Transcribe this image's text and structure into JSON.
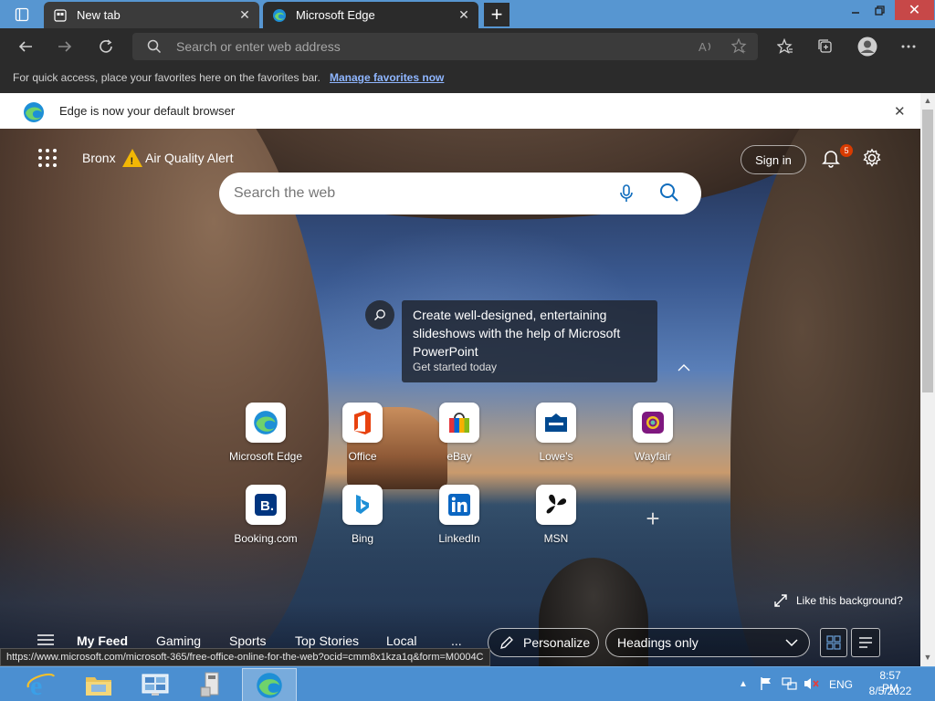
{
  "tabs": [
    {
      "title": "New tab",
      "icon": "newtab-icon"
    },
    {
      "title": "Microsoft Edge",
      "icon": "edge-logo-icon"
    }
  ],
  "toolbar": {
    "address_placeholder": "Search or enter web address"
  },
  "favorites_bar": {
    "message": "For quick access, place your favorites here on the favorites bar.",
    "link": "Manage favorites now"
  },
  "notification": {
    "text": "Edge is now your default browser"
  },
  "newtab": {
    "location": "Bronx",
    "alert": "Air Quality Alert",
    "sign_in": "Sign in",
    "notification_count": "5",
    "search_placeholder": "Search the web",
    "promo": {
      "title": "Create well-designed, entertaining slideshows with the help of Microsoft PowerPoint",
      "subtitle": "Get started today"
    },
    "tiles_row1": [
      "Microsoft Edge",
      "Office",
      "eBay",
      "Lowe's",
      "Wayfair"
    ],
    "tiles_row2": [
      "Booking.com",
      "Bing",
      "LinkedIn",
      "MSN"
    ],
    "like_background": "Like this background?"
  },
  "feed": {
    "tabs": [
      "My Feed",
      "Gaming",
      "Sports",
      "Top Stories",
      "Local"
    ],
    "more": "...",
    "personalize": "Personalize",
    "headings": "Headings only"
  },
  "status_url": "https://www.microsoft.com/microsoft-365/free-office-online-for-the-web?ocid=cmm8x1kza1q&form=M0004C",
  "taskbar": {
    "language": "ENG",
    "time": "8:57 PM",
    "date": "8/5/2022"
  },
  "colors": {
    "titlebar": "#5796d1",
    "toolbar": "#2b2b2b",
    "taskbar": "#4b8fd1",
    "link": "#8fb6ff",
    "badge": "#d83b01"
  }
}
